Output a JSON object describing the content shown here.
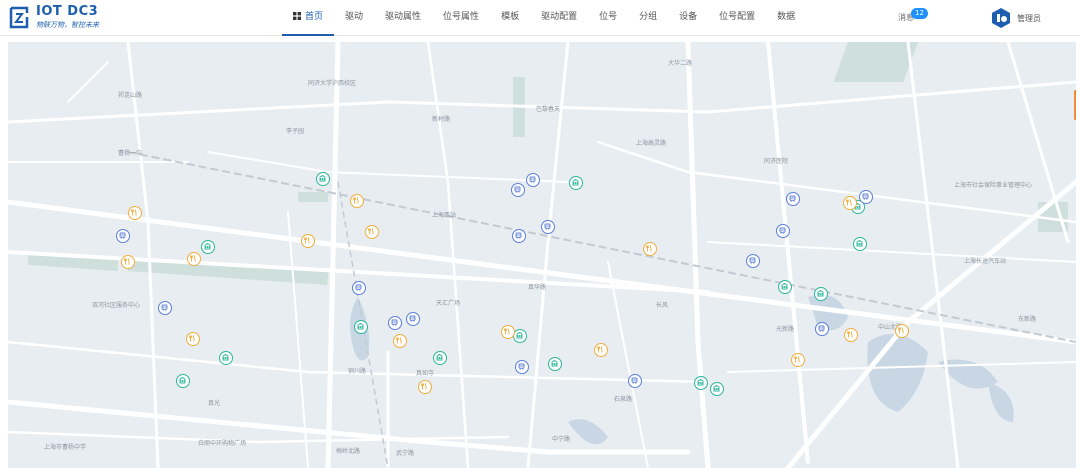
{
  "app": {
    "title": "IOT DC3",
    "slogan": "物联万物，智控未来"
  },
  "nav": {
    "items": [
      {
        "label": "首页",
        "active": true
      },
      {
        "label": "驱动"
      },
      {
        "label": "驱动属性"
      },
      {
        "label": "位号属性"
      },
      {
        "label": "模板"
      },
      {
        "label": "驱动配置"
      },
      {
        "label": "位号"
      },
      {
        "label": "分组"
      },
      {
        "label": "设备"
      },
      {
        "label": "位号配置"
      },
      {
        "label": "数据"
      }
    ]
  },
  "user": {
    "messages_label": "消息",
    "messages_count": "12",
    "name": "管理员"
  },
  "colors": {
    "accent": "#1d5fae",
    "marker_green": "#2ab59b",
    "marker_blue": "#5b7ed8",
    "marker_orange": "#f0ad3b",
    "badge": "#1e90ff"
  },
  "map": {
    "labels": [
      "同济大学沪西校区",
      "铜川路",
      "真如寺",
      "真光",
      "中宁路",
      "武宁路",
      "李子园",
      "新村路",
      "巴黎春天",
      "上海西站",
      "真华路",
      "天汇广场",
      "光新路",
      "中山北路",
      "大华二路",
      "同济医院",
      "上海市社会保险事业管理中心",
      "上海长途汽车站",
      "双河社区服务中心",
      "梅岭北路",
      "石泉路",
      "长风",
      "白丽中环购物广场",
      "上海市曹杨中学",
      "祁连山路",
      "上海高灵路",
      "曹杨一中",
      "东新路"
    ],
    "markers": [
      {
        "type": "green",
        "icon": "building-icon"
      },
      {
        "type": "green",
        "icon": "building-icon"
      },
      {
        "type": "green",
        "icon": "building-icon"
      },
      {
        "type": "green",
        "icon": "building-icon"
      },
      {
        "type": "green",
        "icon": "building-icon"
      },
      {
        "type": "green",
        "icon": "building-icon"
      },
      {
        "type": "green",
        "icon": "building-icon"
      },
      {
        "type": "green",
        "icon": "building-icon"
      },
      {
        "type": "green",
        "icon": "building-icon"
      },
      {
        "type": "green",
        "icon": "building-icon"
      },
      {
        "type": "green",
        "icon": "building-icon"
      },
      {
        "type": "green",
        "icon": "building-icon"
      },
      {
        "type": "green",
        "icon": "building-icon"
      },
      {
        "type": "green",
        "icon": "building-icon"
      },
      {
        "type": "green",
        "icon": "building-icon"
      },
      {
        "type": "blue",
        "icon": "bus-icon"
      },
      {
        "type": "blue",
        "icon": "bus-icon"
      },
      {
        "type": "blue",
        "icon": "bus-icon"
      },
      {
        "type": "blue",
        "icon": "bus-icon"
      },
      {
        "type": "blue",
        "icon": "bus-icon"
      },
      {
        "type": "blue",
        "icon": "bus-icon"
      },
      {
        "type": "blue",
        "icon": "bus-icon"
      },
      {
        "type": "blue",
        "icon": "bus-icon"
      },
      {
        "type": "blue",
        "icon": "bus-icon"
      },
      {
        "type": "blue",
        "icon": "bus-icon"
      },
      {
        "type": "blue",
        "icon": "bus-icon"
      },
      {
        "type": "blue",
        "icon": "bus-icon"
      },
      {
        "type": "blue",
        "icon": "bus-icon"
      },
      {
        "type": "blue",
        "icon": "bus-icon"
      },
      {
        "type": "blue",
        "icon": "bus-icon"
      },
      {
        "type": "orange",
        "icon": "restaurant-icon"
      },
      {
        "type": "orange",
        "icon": "restaurant-icon"
      },
      {
        "type": "orange",
        "icon": "restaurant-icon"
      },
      {
        "type": "orange",
        "icon": "restaurant-icon"
      },
      {
        "type": "orange",
        "icon": "restaurant-icon"
      },
      {
        "type": "orange",
        "icon": "restaurant-icon"
      },
      {
        "type": "orange",
        "icon": "restaurant-icon"
      },
      {
        "type": "orange",
        "icon": "restaurant-icon"
      },
      {
        "type": "orange",
        "icon": "restaurant-icon"
      },
      {
        "type": "orange",
        "icon": "restaurant-icon"
      },
      {
        "type": "orange",
        "icon": "restaurant-icon"
      },
      {
        "type": "orange",
        "icon": "restaurant-icon"
      },
      {
        "type": "orange",
        "icon": "restaurant-icon"
      },
      {
        "type": "orange",
        "icon": "restaurant-icon"
      }
    ]
  }
}
